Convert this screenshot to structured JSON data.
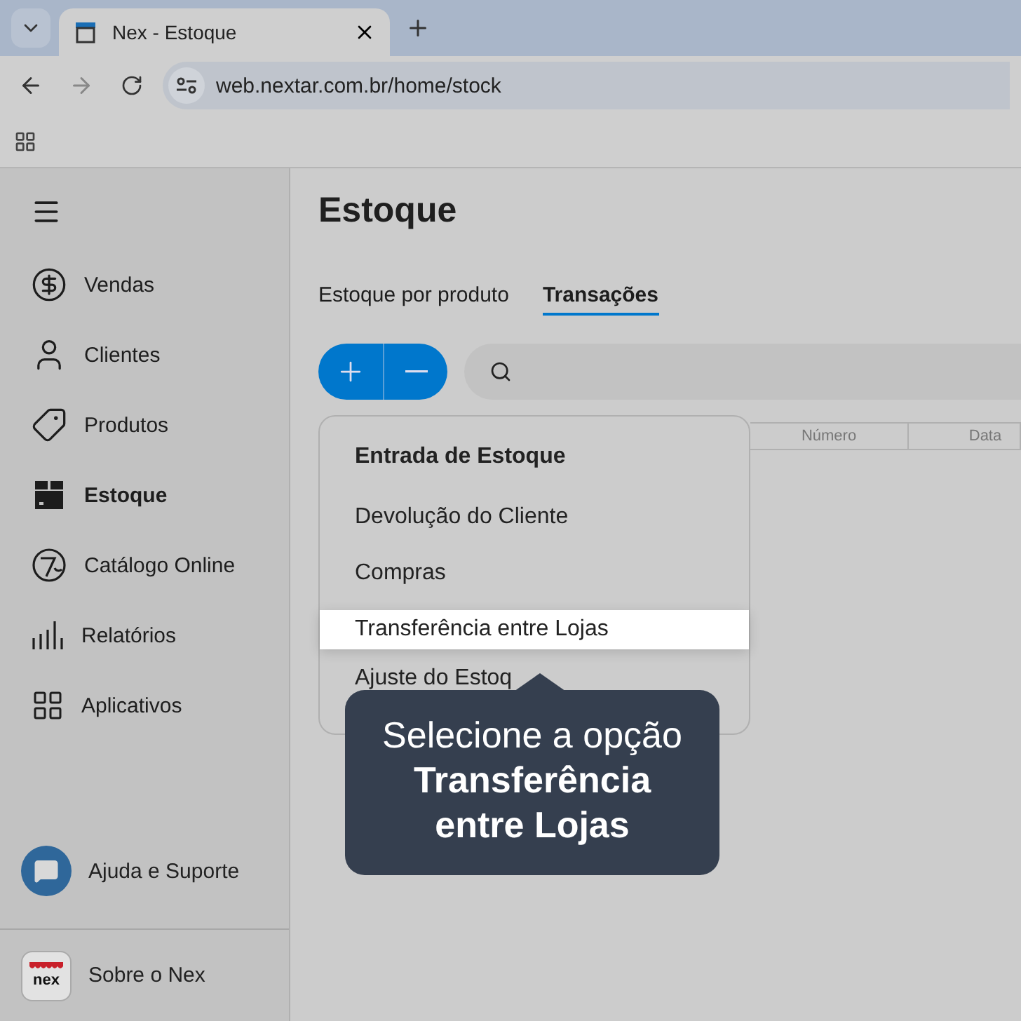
{
  "browser": {
    "tabs": [
      {
        "title": "Nex - Estoque",
        "selected": true
      }
    ],
    "address": "web.nextar.com.br/home/stock"
  },
  "sidebar": {
    "items": [
      {
        "label": "Vendas",
        "selected": false
      },
      {
        "label": "Clientes",
        "selected": false
      },
      {
        "label": "Produtos",
        "selected": false
      },
      {
        "label": "Estoque",
        "selected": true
      },
      {
        "label": "Catálogo Online",
        "selected": false
      },
      {
        "label": "Relatórios",
        "selected": false
      },
      {
        "label": "Aplicativos",
        "selected": false
      }
    ],
    "help": {
      "label": "Ajuda e Suporte"
    },
    "about": {
      "label": "Sobre o Nex",
      "logo_text": "nex"
    }
  },
  "page": {
    "title": "Estoque",
    "tabs": [
      {
        "label": "Estoque por produto",
        "selected": false
      },
      {
        "label": "Transações",
        "selected": true
      }
    ],
    "table": {
      "columns": [
        "Número",
        "Data"
      ]
    },
    "menu": {
      "heading": "Entrada de Estoque",
      "items": [
        {
          "label": "Devolução do Cliente",
          "selected": false
        },
        {
          "label": "Compras",
          "selected": false
        },
        {
          "label": "Transferência entre Lojas",
          "selected": true
        },
        {
          "label": "Ajuste do Estoq",
          "selected": false
        }
      ]
    },
    "tooltip": "Selecione a opção **Transferência entre Lojas**"
  }
}
